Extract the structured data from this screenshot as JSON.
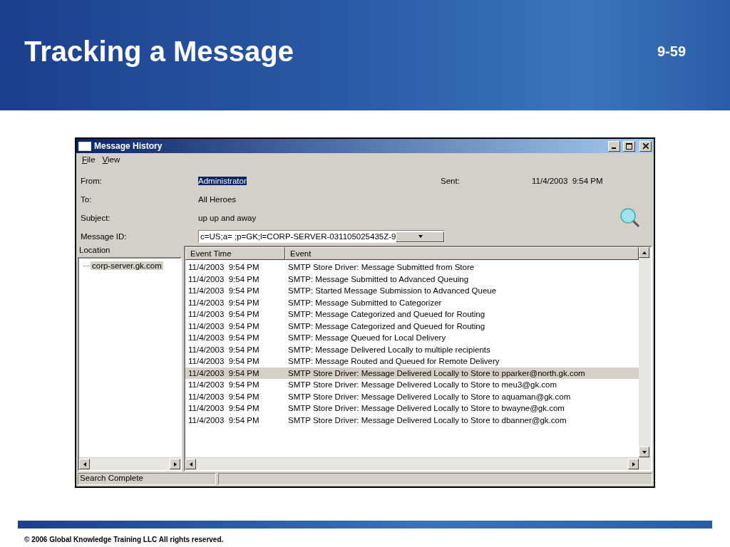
{
  "slide": {
    "title": "Tracking a Message",
    "page": "9-59",
    "copyright": "© 2006 Global Knowledge Training LLC All rights reserved."
  },
  "window": {
    "title": "Message History"
  },
  "menu": [
    {
      "label": "File"
    },
    {
      "label": "View"
    }
  ],
  "fields": [
    {
      "label": "From:",
      "value": "Administrator",
      "selected": true
    },
    {
      "label": "To:",
      "value": "All Heroes",
      "selected": false
    },
    {
      "label": "Subject:",
      "value": "up up and away",
      "selected": false
    }
  ],
  "sent": {
    "label": "Sent:",
    "value": "11/4/2003  9:54 PM"
  },
  "message_id": {
    "label": "Message ID:",
    "value": "c=US;a= ;p=GK;l=CORP-SERVER-031105025435Z-9"
  },
  "location": {
    "header": "Location",
    "items": [
      {
        "label": "corp-server.gk.com",
        "selected": true
      }
    ]
  },
  "events": {
    "columns": [
      "Event Time",
      "Event"
    ],
    "rows": [
      {
        "time": "11/4/2003  9:54 PM",
        "event": "SMTP Store Driver: Message Submitted from Store",
        "selected": false
      },
      {
        "time": "11/4/2003  9:54 PM",
        "event": "SMTP: Message Submitted to Advanced Queuing",
        "selected": false
      },
      {
        "time": "11/4/2003  9:54 PM",
        "event": "SMTP: Started Message Submission to Advanced Queue",
        "selected": false
      },
      {
        "time": "11/4/2003  9:54 PM",
        "event": "SMTP: Message Submitted to Categorizer",
        "selected": false
      },
      {
        "time": "11/4/2003  9:54 PM",
        "event": "SMTP: Message Categorized and Queued for Routing",
        "selected": false
      },
      {
        "time": "11/4/2003  9:54 PM",
        "event": "SMTP: Message Categorized and Queued for Routing",
        "selected": false
      },
      {
        "time": "11/4/2003  9:54 PM",
        "event": "SMTP: Message Queued for Local Delivery",
        "selected": false
      },
      {
        "time": "11/4/2003  9:54 PM",
        "event": "SMTP: Message Delivered Locally to multiple recipients",
        "selected": false
      },
      {
        "time": "11/4/2003  9:54 PM",
        "event": "SMTP: Message Routed and Queued for Remote Delivery",
        "selected": false
      },
      {
        "time": "11/4/2003  9:54 PM",
        "event": "SMTP Store Driver: Message Delivered Locally to Store to pparker@north.gk.com",
        "selected": true
      },
      {
        "time": "11/4/2003  9:54 PM",
        "event": "SMTP Store Driver: Message Delivered Locally to Store to meu3@gk.com",
        "selected": false
      },
      {
        "time": "11/4/2003  9:54 PM",
        "event": "SMTP Store Driver: Message Delivered Locally to Store to aquaman@gk.com",
        "selected": false
      },
      {
        "time": "11/4/2003  9:54 PM",
        "event": "SMTP Store Driver: Message Delivered Locally to Store to bwayne@gk.com",
        "selected": false
      },
      {
        "time": "11/4/2003  9:54 PM",
        "event": "SMTP Store Driver: Message Delivered Locally to Store to dbanner@gk.com",
        "selected": false
      }
    ]
  },
  "status_bar": {
    "text": "Search Complete"
  }
}
